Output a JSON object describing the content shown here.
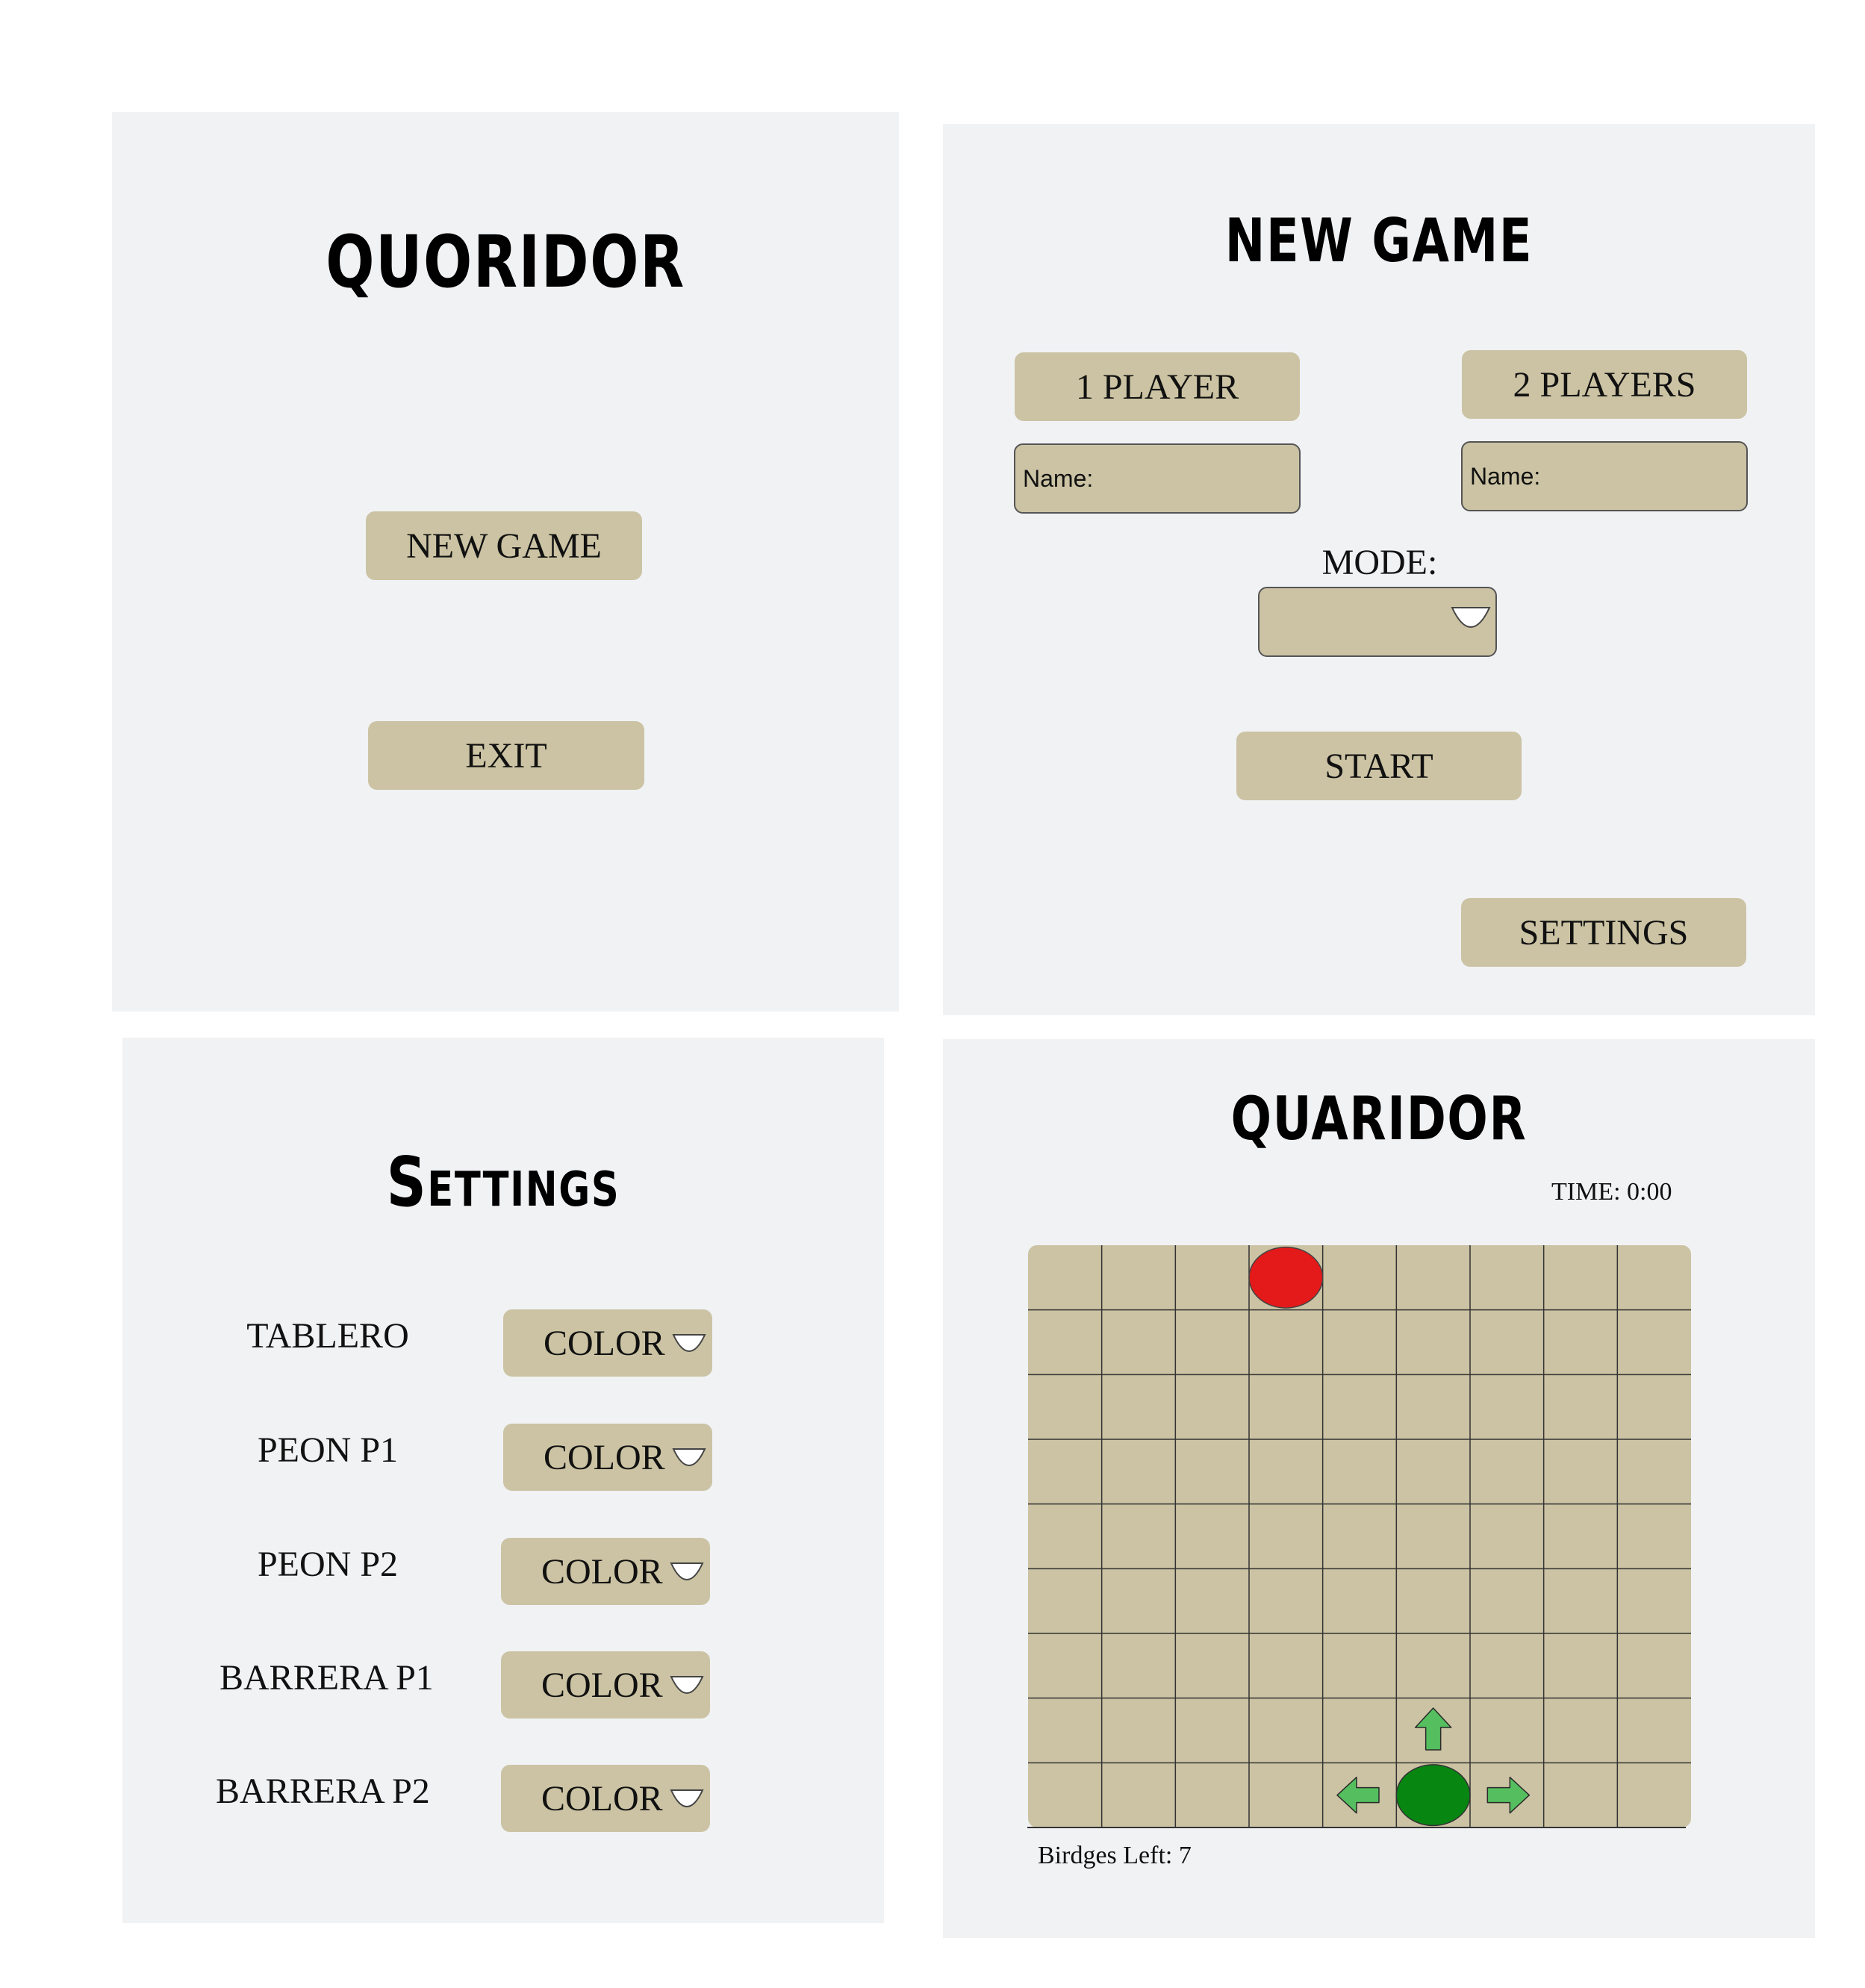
{
  "menu": {
    "title": "QUORIDOR",
    "new_game_label": "NEW GAME",
    "exit_label": "EXIT"
  },
  "new_game": {
    "title": "NEW GAME",
    "one_player_label": "1 PLAYER",
    "two_players_label": "2 PLAYERS",
    "name_p1_placeholder": "Name:",
    "name_p2_placeholder": "Name:",
    "mode_label": "MODE:",
    "mode_value": "",
    "start_label": "START",
    "settings_label": "SETTINGS"
  },
  "settings": {
    "title": "Settings",
    "rows": [
      {
        "label": "TABLERO",
        "value": "COLOR"
      },
      {
        "label": "PEON P1",
        "value": "COLOR"
      },
      {
        "label": "PEON P2",
        "value": "COLOR"
      },
      {
        "label": "BARRERA P1",
        "value": "COLOR"
      },
      {
        "label": "BARRERA P2",
        "value": "COLOR"
      }
    ]
  },
  "game": {
    "title": "QUARIDOR",
    "time_text": "TIME: 0:00",
    "bridges_text": "Birdges Left: 7",
    "board": {
      "columns": 9,
      "rows": 9,
      "red_pawn": {
        "col": 4,
        "row": 1
      },
      "green_pawn": {
        "col": 6,
        "row": 9
      },
      "move_hints": [
        "up",
        "left",
        "right"
      ]
    }
  },
  "colors": {
    "panel_bg": "#f1f2f4",
    "button_bg": "#cbc3a3",
    "board_bg": "#cbc3a3",
    "red_pawn": "#e41919",
    "green_pawn": "#078612",
    "hint_arrow": "#55bf5f"
  }
}
